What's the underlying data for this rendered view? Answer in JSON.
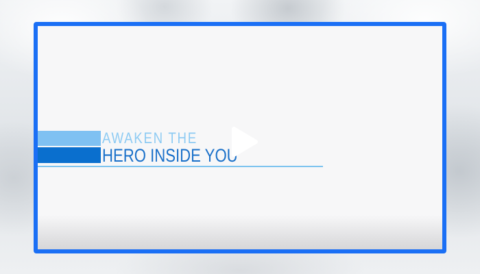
{
  "video": {
    "tagline_top": "AWAKEN THE",
    "tagline_bottom": "HERO INSIDE YOU",
    "play_icon": "play-icon",
    "frame_color": "#1a6ff5"
  },
  "colors": {
    "accent_light": "#7fc1f2",
    "accent_dark": "#0a6fce",
    "text_light": "#8ecbf3",
    "text_dark": "#1a70c9"
  }
}
